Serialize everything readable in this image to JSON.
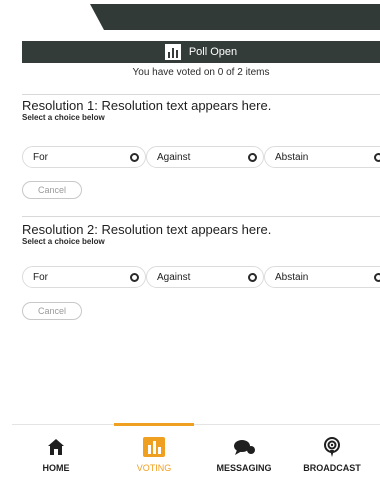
{
  "header": {
    "title": "Poll Open",
    "status": "You have voted on 0 of 2 items"
  },
  "resolutions": [
    {
      "title": "Resolution 1: Resolution text appears here.",
      "hint": "Select a choice below",
      "options": [
        "For",
        "Against",
        "Abstain"
      ],
      "cancel_label": "Cancel"
    },
    {
      "title": "Resolution 2: Resolution text appears here.",
      "hint": "Select a choice below",
      "options": [
        "For",
        "Against",
        "Abstain"
      ],
      "cancel_label": "Cancel"
    }
  ],
  "nav": {
    "items": [
      {
        "label": "HOME",
        "icon": "home-icon"
      },
      {
        "label": "VOTING",
        "icon": "voting-chart-icon"
      },
      {
        "label": "MESSAGING",
        "icon": "chat-bubbles-icon"
      },
      {
        "label": "BROADCAST",
        "icon": "broadcast-icon"
      }
    ],
    "active": "VOTING"
  },
  "colors": {
    "header_bg": "#343c39",
    "accent": "#f0a020",
    "text": "#1f1f1f"
  }
}
